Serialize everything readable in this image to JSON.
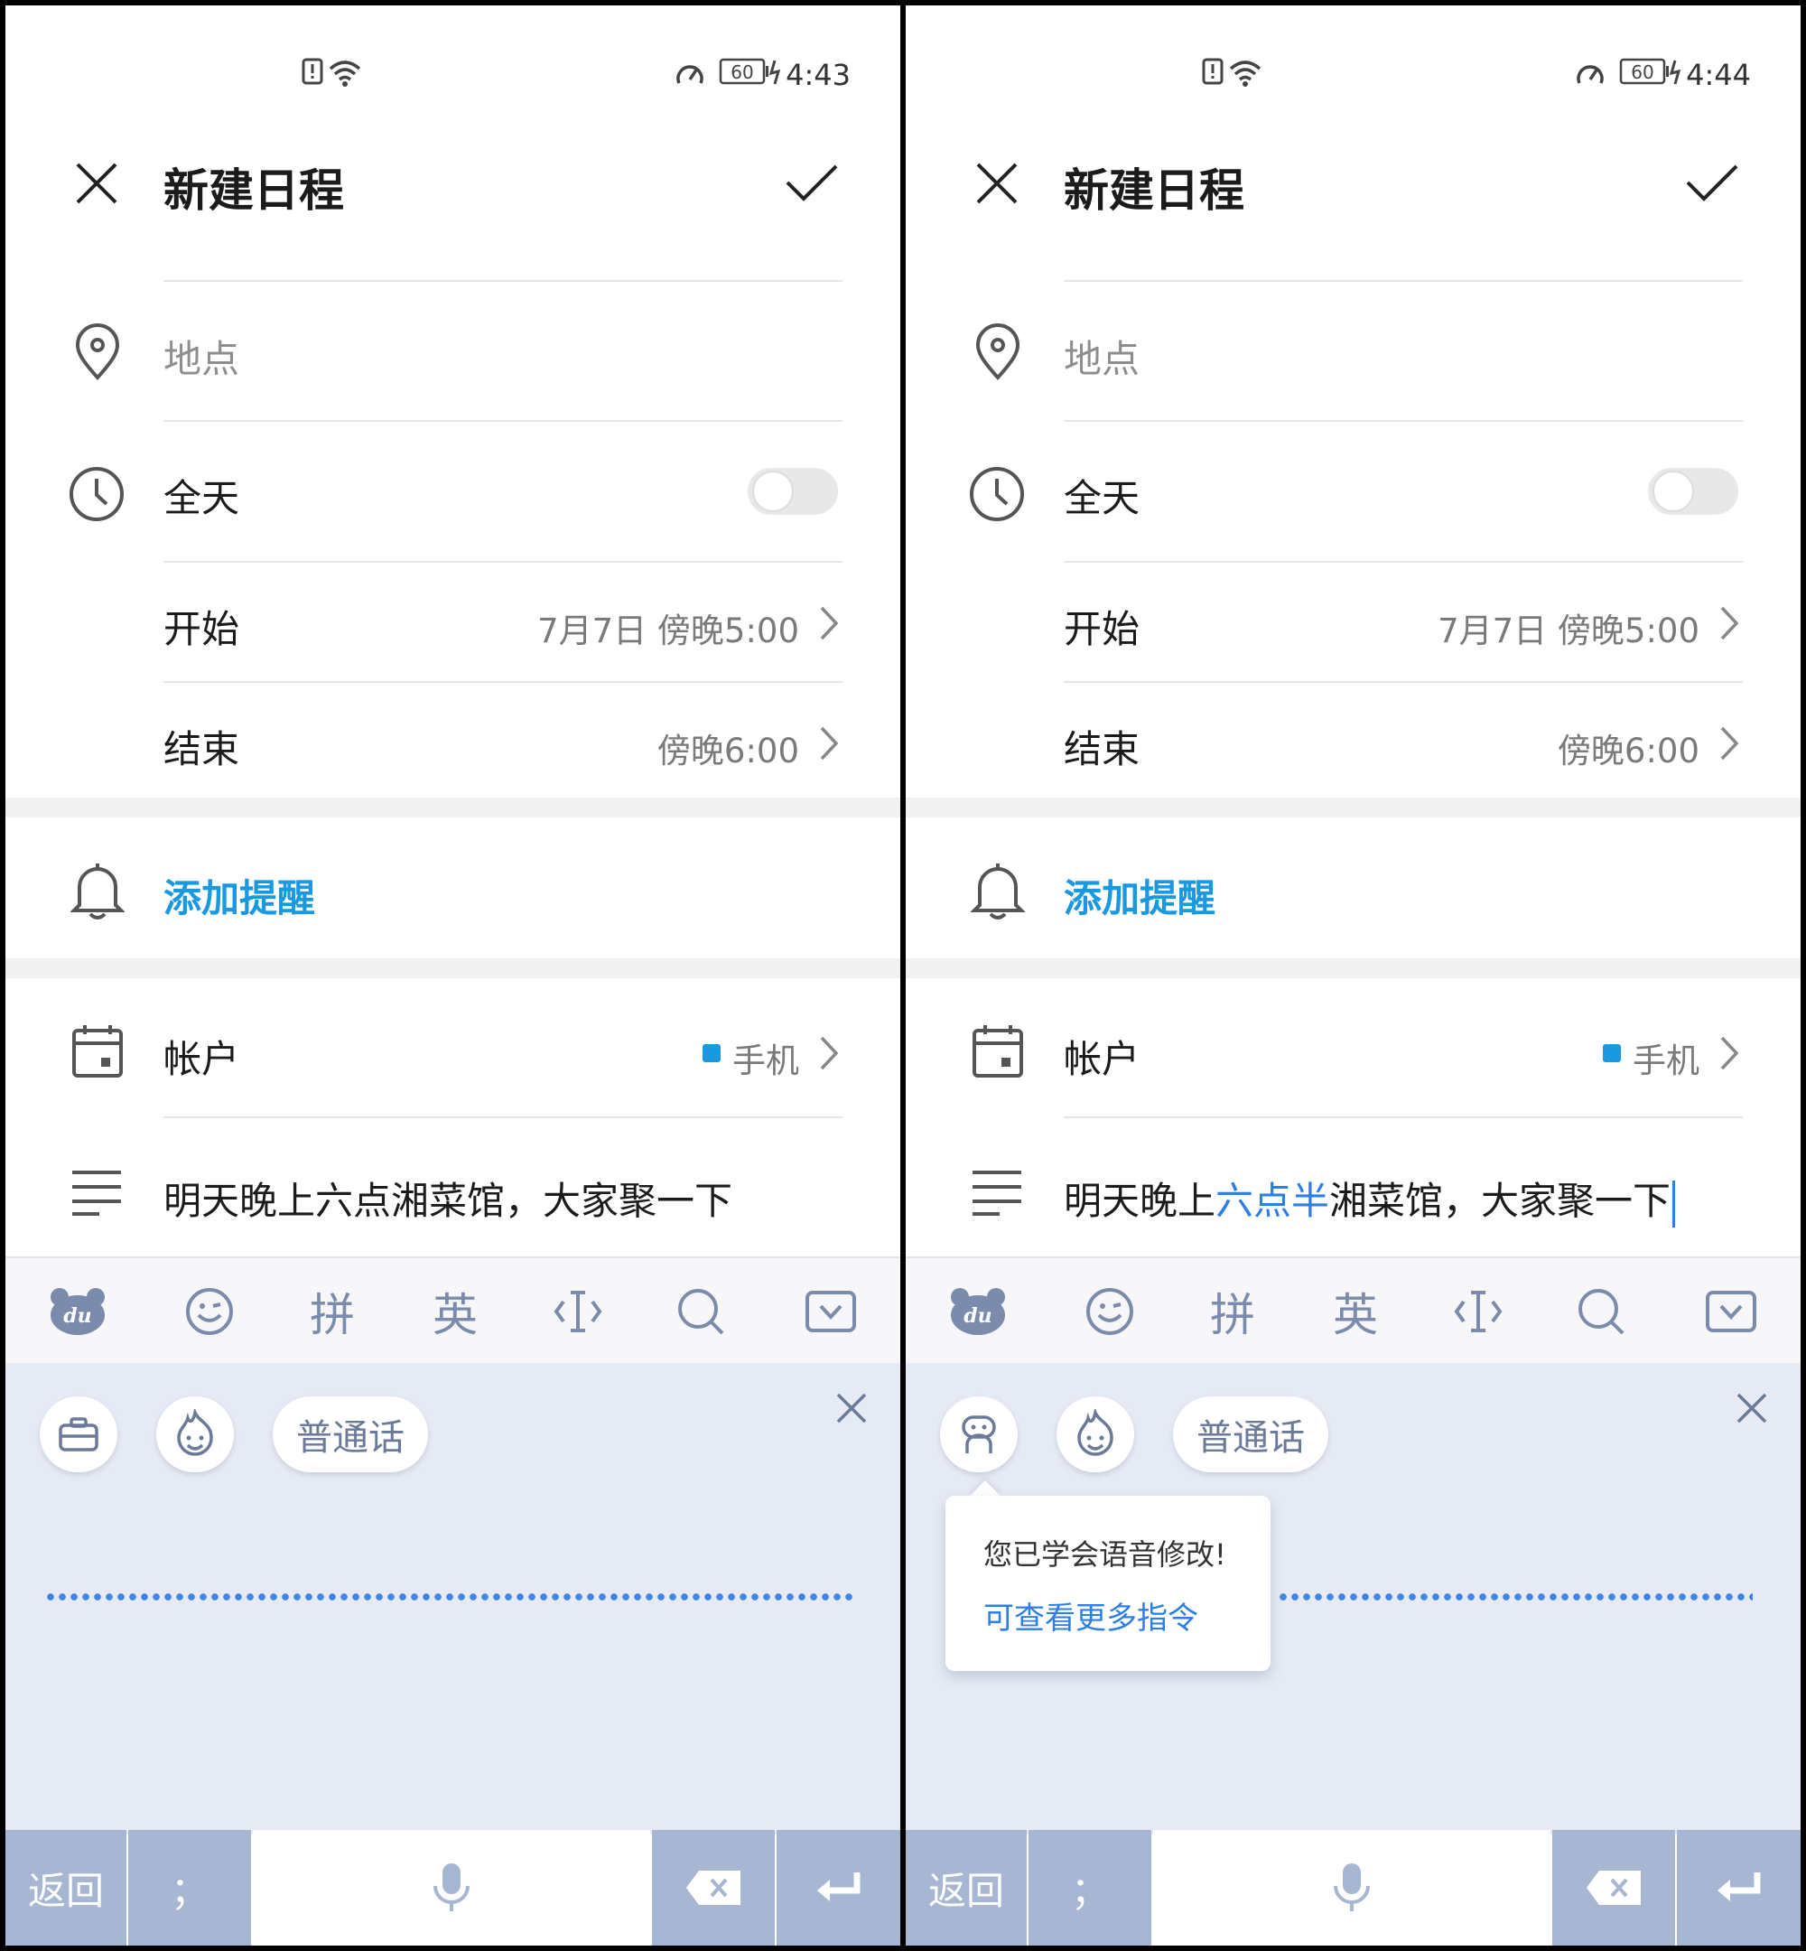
{
  "colors": {
    "accent": "#1a98e0",
    "voice_blue": "#2e7ee8",
    "keyboard_gray": "#a7b6d2",
    "voice_bg": "#e6eaf4"
  },
  "screens": [
    {
      "status": {
        "time": "4:43",
        "battery": "60"
      },
      "header": {
        "title": "新建日程"
      },
      "location": {
        "placeholder": "地点"
      },
      "allday": {
        "label": "全天"
      },
      "start": {
        "label": "开始",
        "value": "7月7日 傍晚5:00"
      },
      "end": {
        "label": "结束",
        "value": "傍晚6:00"
      },
      "reminder": {
        "label": "添加提醒"
      },
      "account": {
        "label": "帐户",
        "value": "手机"
      },
      "description": {
        "before": "明天晚上六点湘菜馆，大家聚一下",
        "highlight": "",
        "after": ""
      },
      "keyboard": {
        "toolbar": [
          "拼",
          "英"
        ],
        "pills": {
          "mandarin": "普通话"
        },
        "keys": {
          "back": "返回",
          "semicolon": "；"
        }
      }
    },
    {
      "status": {
        "time": "4:44",
        "battery": "60"
      },
      "header": {
        "title": "新建日程"
      },
      "location": {
        "placeholder": "地点"
      },
      "allday": {
        "label": "全天"
      },
      "start": {
        "label": "开始",
        "value": "7月7日 傍晚5:00"
      },
      "end": {
        "label": "结束",
        "value": "傍晚6:00"
      },
      "reminder": {
        "label": "添加提醒"
      },
      "account": {
        "label": "帐户",
        "value": "手机"
      },
      "description": {
        "before": "明天晚上",
        "highlight": "六点半",
        "after": "湘菜馆，大家聚一下"
      },
      "keyboard": {
        "toolbar": [
          "拼",
          "英"
        ],
        "pills": {
          "mandarin": "普通话"
        },
        "keys": {
          "back": "返回",
          "semicolon": "；"
        }
      },
      "tooltip": {
        "message": "您已学会语音修改!",
        "link": "可查看更多指令"
      }
    }
  ]
}
